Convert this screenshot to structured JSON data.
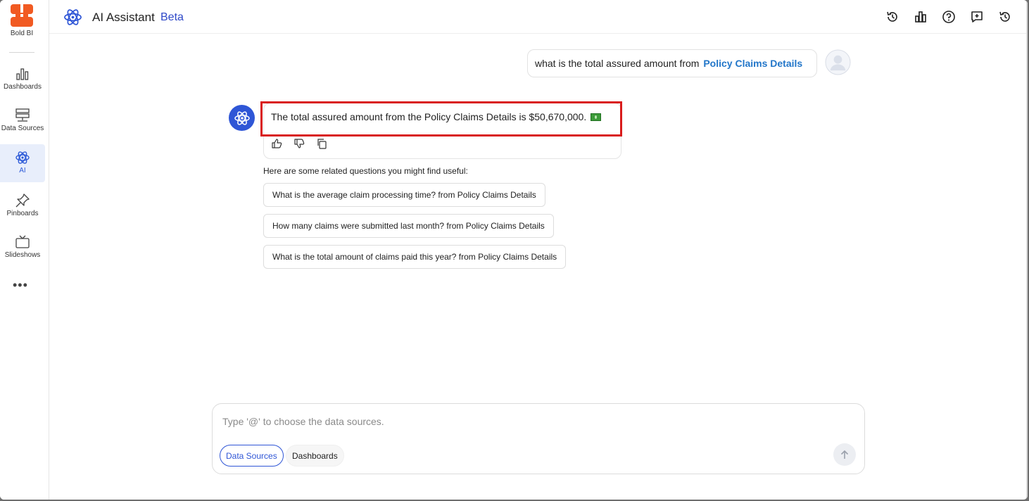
{
  "brand": {
    "name": "Bold BI"
  },
  "sidebar": {
    "items": [
      {
        "label": "Dashboards",
        "icon": "bar-chart-icon"
      },
      {
        "label": "Data Sources",
        "icon": "database-icon"
      },
      {
        "label": "AI",
        "icon": "ai-atom-icon",
        "active": true
      },
      {
        "label": "Pinboards",
        "icon": "pin-icon"
      },
      {
        "label": "Slideshows",
        "icon": "slideshow-icon"
      }
    ],
    "more": "•••"
  },
  "header": {
    "title": "AI Assistant",
    "badge": "Beta",
    "actions": [
      "history-icon",
      "analytics-icon",
      "help-icon",
      "new-chat-icon",
      "restore-icon"
    ]
  },
  "chat": {
    "user_message": {
      "prefix": "what is the total assured amount from",
      "source": "Policy Claims Details"
    },
    "answer": {
      "text": "The total assured amount from the Policy Claims Details is $50,670,000."
    },
    "related_title": "Here are some related questions you might find useful:",
    "related_questions": [
      "What is the average claim processing time? from Policy Claims Details",
      "How many claims were submitted last month? from Policy Claims Details",
      "What is the total amount of claims paid this year? from Policy Claims Details"
    ]
  },
  "composer": {
    "placeholder": "Type '@' to choose the data sources.",
    "value": "",
    "pills": [
      "Data Sources",
      "Dashboards"
    ]
  },
  "colors": {
    "accent": "#2f56d6",
    "source_link": "#2276c9",
    "highlight": "#d91c1c",
    "brand_orange": "#f15a22"
  }
}
